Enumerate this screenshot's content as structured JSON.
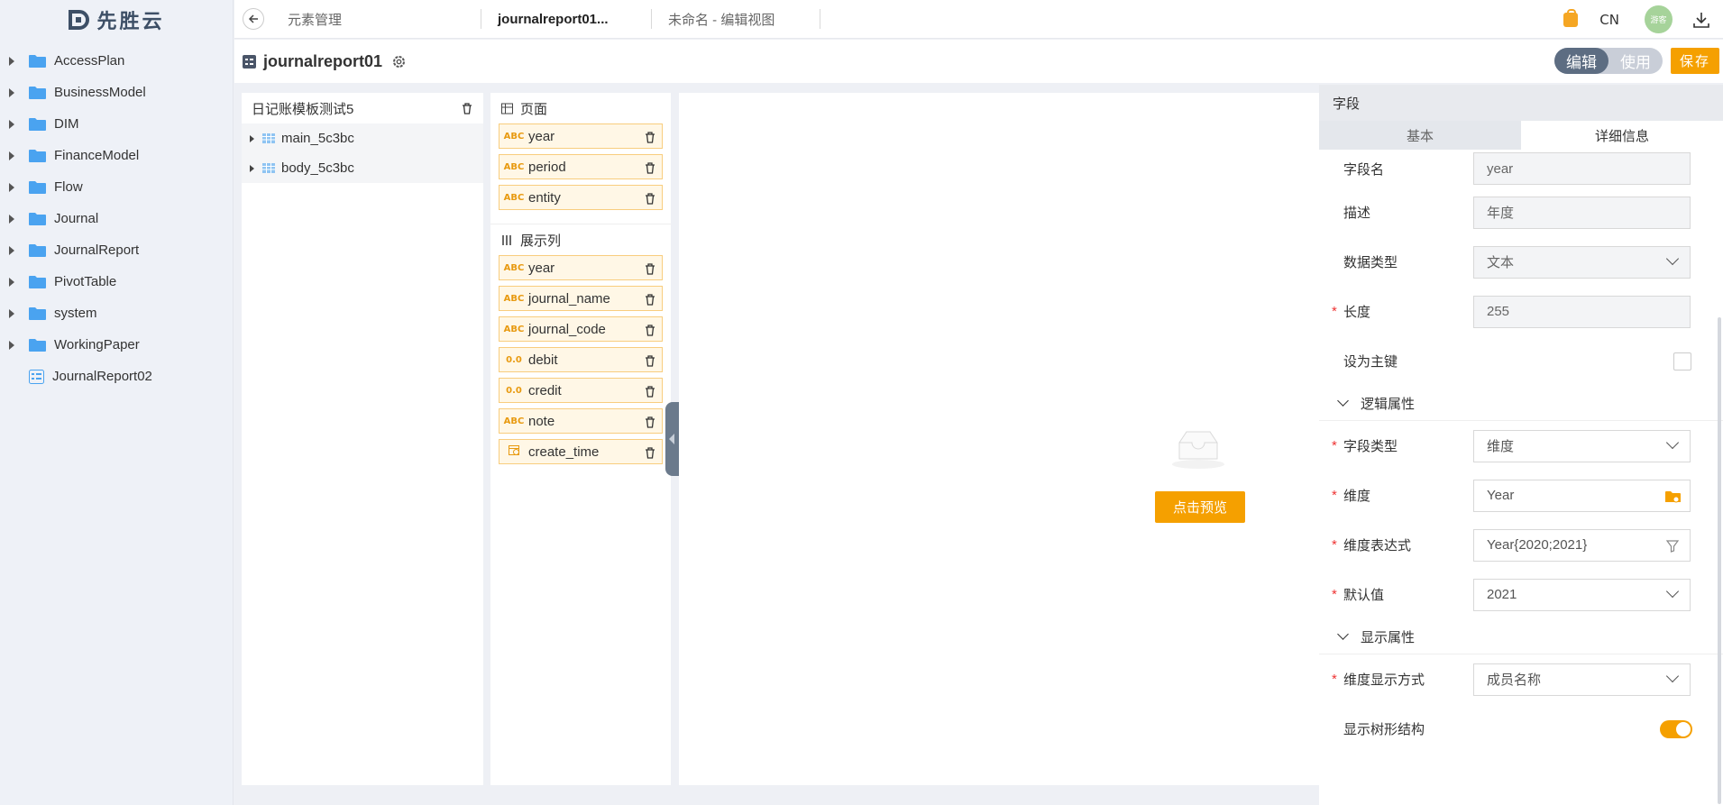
{
  "logo": {
    "text": "先胜云"
  },
  "sidebar": {
    "items": [
      {
        "label": "AccessPlan",
        "type": "folder"
      },
      {
        "label": "BusinessModel",
        "type": "folder"
      },
      {
        "label": "DIM",
        "type": "folder"
      },
      {
        "label": "FinanceModel",
        "type": "folder"
      },
      {
        "label": "Flow",
        "type": "folder"
      },
      {
        "label": "Journal",
        "type": "folder"
      },
      {
        "label": "JournalReport",
        "type": "folder"
      },
      {
        "label": "PivotTable",
        "type": "folder"
      },
      {
        "label": "system",
        "type": "folder"
      },
      {
        "label": "WorkingPaper",
        "type": "folder"
      },
      {
        "label": "JournalReport02",
        "type": "document"
      }
    ]
  },
  "topbar": {
    "tabs": [
      "元素管理",
      "journalreport01...",
      "未命名 - 编辑视图"
    ],
    "lang": "CN",
    "avatar_text": "游客"
  },
  "titlebar": {
    "title": "journalreport01",
    "mode_edit": "编辑",
    "mode_use": "使用",
    "save_label": "保存"
  },
  "panel_tables": {
    "title": "日记账模板测试5",
    "tables": [
      "main_5c3bc",
      "body_5c3bc"
    ]
  },
  "panel_fields": {
    "page_section": "页面",
    "page_fields": [
      {
        "type": "ABC",
        "name": "year"
      },
      {
        "type": "ABC",
        "name": "period"
      },
      {
        "type": "ABC",
        "name": "entity"
      }
    ],
    "column_section": "展示列",
    "column_fields": [
      {
        "type": "ABC",
        "name": "year"
      },
      {
        "type": "ABC",
        "name": "journal_name"
      },
      {
        "type": "ABC",
        "name": "journal_code"
      },
      {
        "type": "0.0",
        "name": "debit"
      },
      {
        "type": "0.0",
        "name": "credit"
      },
      {
        "type": "ABC",
        "name": "note"
      },
      {
        "type": "date",
        "name": "create_time"
      }
    ]
  },
  "preview": {
    "button_label": "点击预览"
  },
  "props": {
    "header": "字段",
    "tab_basic": "基本",
    "tab_detail": "详细信息",
    "field_name_label": "字段名",
    "field_name_value": "year",
    "desc_label": "描述",
    "desc_value": "年度",
    "datatype_label": "数据类型",
    "datatype_value": "文本",
    "length_label": "长度",
    "length_value": "255",
    "primary_label": "设为主键",
    "logic_group": "逻辑属性",
    "fieldtype_label": "字段类型",
    "fieldtype_value": "维度",
    "dimension_label": "维度",
    "dimension_value": "Year",
    "dimexpr_label": "维度表达式",
    "dimexpr_value": "Year{2020;2021}",
    "default_label": "默认值",
    "default_value": "2021",
    "display_group": "显示属性",
    "dimdisplay_label": "维度显示方式",
    "dimdisplay_value": "成员名称",
    "tree_label": "显示树形结构",
    "tree_on": true
  },
  "colors": {
    "accent": "#f5a000",
    "field_bg": "#fff7e6",
    "folder": "#4aa3f0"
  }
}
